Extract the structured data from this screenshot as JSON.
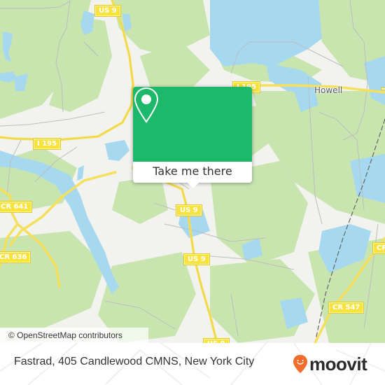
{
  "map": {
    "colors": {
      "land": "#f2f2ee",
      "forest": "#c8e5b0",
      "water": "#a6d8ef",
      "major_road": "#f5e05e",
      "minor_road": "#b9b9b9",
      "shield": "#f7e23e"
    },
    "road_shields": [
      {
        "id": "us9-top",
        "label": "US 9"
      },
      {
        "id": "i195-right",
        "label": "I 195"
      },
      {
        "id": "i195-left",
        "label": "I 195"
      },
      {
        "id": "cr641",
        "label": "CR 641"
      },
      {
        "id": "cr636",
        "label": "CR 636"
      },
      {
        "id": "us9-mid",
        "label": "US 9"
      },
      {
        "id": "us9-lower",
        "label": "US 9"
      },
      {
        "id": "us9-bottom",
        "label": "US 9"
      },
      {
        "id": "cr547",
        "label": "CR 547"
      },
      {
        "id": "cr-right",
        "label": "CR"
      }
    ],
    "place_labels": [
      {
        "id": "howell",
        "label": "Howell"
      }
    ],
    "attribution": "© OpenStreetMap contributors"
  },
  "popup": {
    "icon": "map-pin-icon",
    "button_label": "Take me there",
    "accent_color": "#1db86a"
  },
  "footer": {
    "address": "Fastrad, 405 Candlewood CMNS, New York City",
    "logo": {
      "text": "moovit",
      "icon": "moovit-smiley-pin-icon",
      "color": "#f26c2c"
    }
  }
}
